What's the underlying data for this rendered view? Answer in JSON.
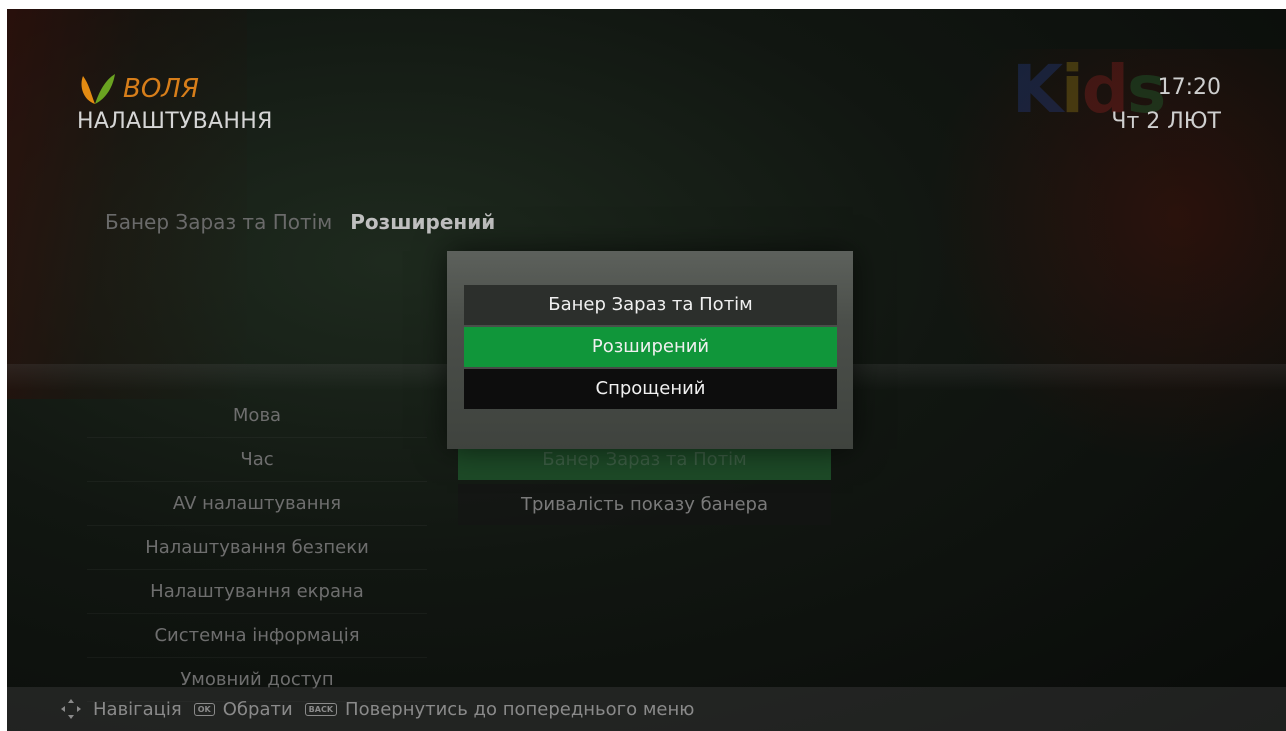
{
  "header": {
    "brand_name": "ВОЛЯ",
    "page_title": "НАЛАШТУВАННЯ",
    "time": "17:20",
    "date": "Чт 2 ЛЮТ",
    "channel_logo": "Kids"
  },
  "current_setting": {
    "name": "Банер Зараз та Потім",
    "value": "Розширений"
  },
  "side_menu": [
    {
      "label": "Мова"
    },
    {
      "label": "Час"
    },
    {
      "label": "AV налаштування"
    },
    {
      "label": "Налаштування безпеки"
    },
    {
      "label": "Налаштування екрана"
    },
    {
      "label": "Системна інформація"
    },
    {
      "label": "Умовний доступ"
    }
  ],
  "sub_menu": [
    {
      "label": "Банер Зараз та Потім"
    },
    {
      "label": "Тривалість показу банера"
    }
  ],
  "popup": {
    "title": "Банер Зараз та Потім",
    "options": [
      "Розширений",
      "Спрощений"
    ],
    "selected": "Розширений"
  },
  "footer": {
    "navigate_label": "Навігація",
    "ok_key": "OK",
    "select_label": "Обрати",
    "back_key": "BACK",
    "back_label": "Повернутись до попереднього меню"
  },
  "colors": {
    "accent_green": "#10963a",
    "brand_orange": "#d77e1a"
  },
  "icons": [
    "voliya-leaf-icon",
    "dpad-navigation-icon",
    "ok-key-icon",
    "back-key-icon"
  ]
}
